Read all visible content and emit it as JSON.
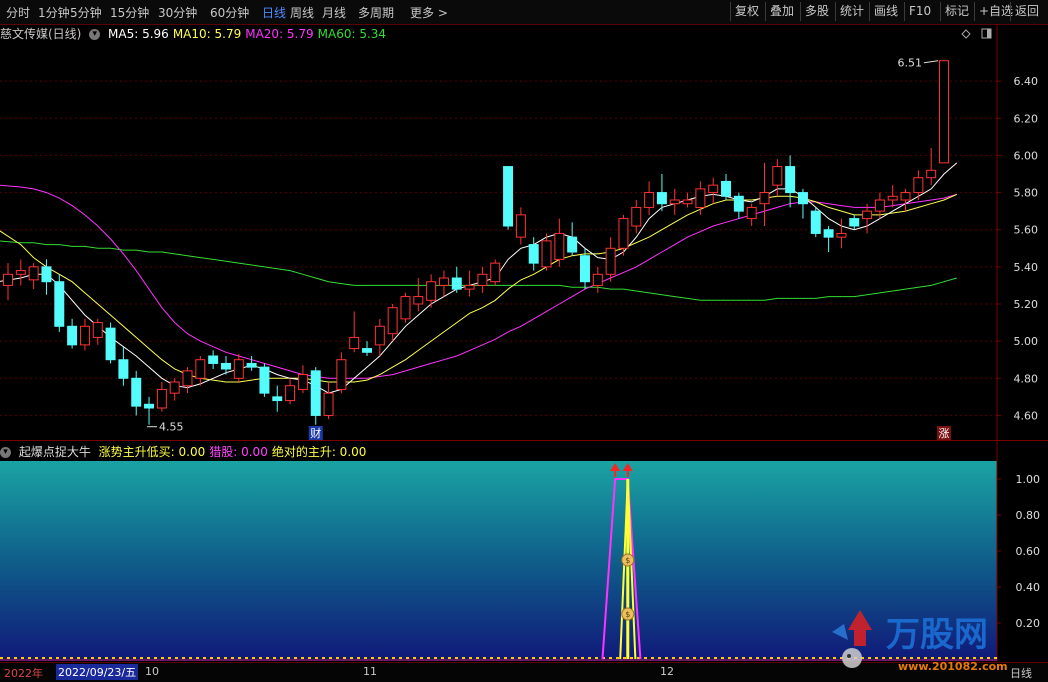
{
  "toolbar": {
    "periods": [
      {
        "label": "分时",
        "active": false
      },
      {
        "label": "1分钟",
        "active": false
      },
      {
        "label": "5分钟",
        "active": false
      },
      {
        "label": "15分钟",
        "active": false
      },
      {
        "label": "30分钟",
        "active": false
      },
      {
        "label": "60分钟",
        "active": false
      },
      {
        "label": "日线",
        "active": true
      },
      {
        "label": "周线",
        "active": false
      },
      {
        "label": "月线",
        "active": false
      },
      {
        "label": "多周期",
        "active": false
      },
      {
        "label": "更多 >",
        "active": false
      }
    ],
    "buttons": [
      "复权",
      "叠加",
      "多股",
      "统计",
      "画线",
      "F10",
      "标记",
      "+自选",
      "返回"
    ]
  },
  "stock": {
    "name": "慈文传媒(日线)",
    "ma": [
      {
        "label": "MA5: 5.96",
        "color": "#ffffff"
      },
      {
        "label": "MA10: 5.79",
        "color": "#ffff55"
      },
      {
        "label": "MA20: 5.79",
        "color": "#ff33ff"
      },
      {
        "label": "MA60: 5.34",
        "color": "#33dd33"
      }
    ]
  },
  "colors": {
    "up": "#ff3333",
    "down": "#54fcfc",
    "axis_line": "#7a0000",
    "grid": "#5a0000"
  },
  "chart_data": [
    {
      "type": "candlestick",
      "title": "慈文传媒(日线)",
      "yticks": [
        4.6,
        4.8,
        5.0,
        5.2,
        5.4,
        5.6,
        5.8,
        6.0,
        6.2,
        6.4
      ],
      "ylim": [
        4.5,
        6.6
      ],
      "annotations": {
        "high_label": "6.51",
        "low_label": "4.55",
        "marker_cai": "财",
        "marker_zhang": "涨"
      },
      "candles": [
        {
          "o": 5.3,
          "h": 5.42,
          "l": 5.22,
          "c": 5.36
        },
        {
          "o": 5.36,
          "h": 5.44,
          "l": 5.3,
          "c": 5.38
        },
        {
          "o": 5.33,
          "h": 5.42,
          "l": 5.28,
          "c": 5.4
        },
        {
          "o": 5.4,
          "h": 5.44,
          "l": 5.25,
          "c": 5.32
        },
        {
          "o": 5.32,
          "h": 5.36,
          "l": 5.05,
          "c": 5.08
        },
        {
          "o": 5.08,
          "h": 5.12,
          "l": 4.96,
          "c": 4.98
        },
        {
          "o": 4.98,
          "h": 5.12,
          "l": 4.95,
          "c": 5.08
        },
        {
          "o": 5.02,
          "h": 5.12,
          "l": 4.98,
          "c": 5.1
        },
        {
          "o": 5.07,
          "h": 5.1,
          "l": 4.88,
          "c": 4.9
        },
        {
          "o": 4.9,
          "h": 4.97,
          "l": 4.76,
          "c": 4.8
        },
        {
          "o": 4.8,
          "h": 4.84,
          "l": 4.6,
          "c": 4.65
        },
        {
          "o": 4.66,
          "h": 4.7,
          "l": 4.55,
          "c": 4.64
        },
        {
          "o": 4.64,
          "h": 4.78,
          "l": 4.62,
          "c": 4.74
        },
        {
          "o": 4.72,
          "h": 4.8,
          "l": 4.68,
          "c": 4.78
        },
        {
          "o": 4.76,
          "h": 4.86,
          "l": 4.72,
          "c": 4.84
        },
        {
          "o": 4.8,
          "h": 4.92,
          "l": 4.76,
          "c": 4.9
        },
        {
          "o": 4.92,
          "h": 4.95,
          "l": 4.85,
          "c": 4.88
        },
        {
          "o": 4.88,
          "h": 4.92,
          "l": 4.82,
          "c": 4.85
        },
        {
          "o": 4.8,
          "h": 4.93,
          "l": 4.78,
          "c": 4.9
        },
        {
          "o": 4.88,
          "h": 4.92,
          "l": 4.84,
          "c": 4.86
        },
        {
          "o": 4.86,
          "h": 4.88,
          "l": 4.7,
          "c": 4.72
        },
        {
          "o": 4.7,
          "h": 4.76,
          "l": 4.62,
          "c": 4.68
        },
        {
          "o": 4.68,
          "h": 4.8,
          "l": 4.66,
          "c": 4.76
        },
        {
          "o": 4.74,
          "h": 4.87,
          "l": 4.72,
          "c": 4.82
        },
        {
          "o": 4.84,
          "h": 4.86,
          "l": 4.55,
          "c": 4.6
        },
        {
          "o": 4.6,
          "h": 4.78,
          "l": 4.58,
          "c": 4.72
        },
        {
          "o": 4.74,
          "h": 4.94,
          "l": 4.72,
          "c": 4.9
        },
        {
          "o": 4.96,
          "h": 5.16,
          "l": 4.94,
          "c": 5.02
        },
        {
          "o": 4.96,
          "h": 5.0,
          "l": 4.92,
          "c": 4.94
        },
        {
          "o": 4.98,
          "h": 5.12,
          "l": 4.92,
          "c": 5.08
        },
        {
          "o": 5.04,
          "h": 5.2,
          "l": 5.0,
          "c": 5.18
        },
        {
          "o": 5.12,
          "h": 5.26,
          "l": 5.1,
          "c": 5.24
        },
        {
          "o": 5.2,
          "h": 5.34,
          "l": 5.16,
          "c": 5.24
        },
        {
          "o": 5.22,
          "h": 5.36,
          "l": 5.18,
          "c": 5.32
        },
        {
          "o": 5.3,
          "h": 5.38,
          "l": 5.24,
          "c": 5.34
        },
        {
          "o": 5.34,
          "h": 5.4,
          "l": 5.26,
          "c": 5.28
        },
        {
          "o": 5.28,
          "h": 5.38,
          "l": 5.24,
          "c": 5.3
        },
        {
          "o": 5.3,
          "h": 5.4,
          "l": 5.26,
          "c": 5.36
        },
        {
          "o": 5.32,
          "h": 5.44,
          "l": 5.3,
          "c": 5.42
        },
        {
          "o": 5.94,
          "h": 5.94,
          "l": 5.6,
          "c": 5.62
        },
        {
          "o": 5.56,
          "h": 5.72,
          "l": 5.52,
          "c": 5.68
        },
        {
          "o": 5.52,
          "h": 5.56,
          "l": 5.38,
          "c": 5.42
        },
        {
          "o": 5.4,
          "h": 5.58,
          "l": 5.38,
          "c": 5.54
        },
        {
          "o": 5.44,
          "h": 5.66,
          "l": 5.4,
          "c": 5.58
        },
        {
          "o": 5.56,
          "h": 5.64,
          "l": 5.46,
          "c": 5.48
        },
        {
          "o": 5.46,
          "h": 5.5,
          "l": 5.28,
          "c": 5.32
        },
        {
          "o": 5.3,
          "h": 5.4,
          "l": 5.26,
          "c": 5.36
        },
        {
          "o": 5.36,
          "h": 5.56,
          "l": 5.32,
          "c": 5.5
        },
        {
          "o": 5.5,
          "h": 5.68,
          "l": 5.46,
          "c": 5.66
        },
        {
          "o": 5.62,
          "h": 5.76,
          "l": 5.58,
          "c": 5.72
        },
        {
          "o": 5.72,
          "h": 5.86,
          "l": 5.68,
          "c": 5.8
        },
        {
          "o": 5.8,
          "h": 5.9,
          "l": 5.7,
          "c": 5.74
        },
        {
          "o": 5.74,
          "h": 5.82,
          "l": 5.68,
          "c": 5.76
        },
        {
          "o": 5.74,
          "h": 5.8,
          "l": 5.72,
          "c": 5.76
        },
        {
          "o": 5.72,
          "h": 5.86,
          "l": 5.68,
          "c": 5.82
        },
        {
          "o": 5.8,
          "h": 5.88,
          "l": 5.74,
          "c": 5.84
        },
        {
          "o": 5.86,
          "h": 5.9,
          "l": 5.76,
          "c": 5.78
        },
        {
          "o": 5.78,
          "h": 5.8,
          "l": 5.66,
          "c": 5.7
        },
        {
          "o": 5.66,
          "h": 5.74,
          "l": 5.62,
          "c": 5.72
        },
        {
          "o": 5.74,
          "h": 5.96,
          "l": 5.62,
          "c": 5.8
        },
        {
          "o": 5.84,
          "h": 5.98,
          "l": 5.78,
          "c": 5.94
        },
        {
          "o": 5.94,
          "h": 6.0,
          "l": 5.72,
          "c": 5.8
        },
        {
          "o": 5.8,
          "h": 5.82,
          "l": 5.66,
          "c": 5.74
        },
        {
          "o": 5.7,
          "h": 5.72,
          "l": 5.56,
          "c": 5.58
        },
        {
          "o": 5.6,
          "h": 5.62,
          "l": 5.48,
          "c": 5.56
        },
        {
          "o": 5.56,
          "h": 5.66,
          "l": 5.5,
          "c": 5.58
        },
        {
          "o": 5.66,
          "h": 5.68,
          "l": 5.6,
          "c": 5.62
        },
        {
          "o": 5.66,
          "h": 5.74,
          "l": 5.58,
          "c": 5.7
        },
        {
          "o": 5.7,
          "h": 5.8,
          "l": 5.66,
          "c": 5.76
        },
        {
          "o": 5.76,
          "h": 5.84,
          "l": 5.72,
          "c": 5.78
        },
        {
          "o": 5.76,
          "h": 5.82,
          "l": 5.7,
          "c": 5.8
        },
        {
          "o": 5.8,
          "h": 5.92,
          "l": 5.76,
          "c": 5.88
        },
        {
          "o": 5.88,
          "h": 6.04,
          "l": 5.84,
          "c": 5.92
        },
        {
          "o": 5.96,
          "h": 6.51,
          "l": 5.96,
          "c": 6.51
        }
      ],
      "ma_values": {
        "ma5": [
          5.32,
          5.34,
          5.36,
          5.36,
          5.3,
          5.22,
          5.14,
          5.08,
          5.02,
          4.97,
          4.92,
          4.86,
          4.8,
          4.76,
          4.75,
          4.77,
          4.8,
          4.83,
          4.85,
          4.87,
          4.85,
          4.82,
          4.8,
          4.79,
          4.76,
          4.72,
          4.74,
          4.8,
          4.86,
          4.92,
          5.0,
          5.08,
          5.14,
          5.2,
          5.24,
          5.28,
          5.3,
          5.32,
          5.34,
          5.44,
          5.5,
          5.52,
          5.56,
          5.58,
          5.56,
          5.5,
          5.45,
          5.44,
          5.48,
          5.56,
          5.66,
          5.72,
          5.74,
          5.76,
          5.78,
          5.79,
          5.78,
          5.76,
          5.75,
          5.78,
          5.82,
          5.82,
          5.78,
          5.72,
          5.66,
          5.62,
          5.6,
          5.62,
          5.66,
          5.7,
          5.74,
          5.78,
          5.82,
          5.9,
          5.96
        ],
        "ma10": [
          5.6,
          5.52,
          5.45,
          5.4,
          5.36,
          5.32,
          5.26,
          5.2,
          5.14,
          5.08,
          5.02,
          4.96,
          4.9,
          4.85,
          4.82,
          4.8,
          4.79,
          4.78,
          4.78,
          4.79,
          4.8,
          4.8,
          4.8,
          4.8,
          4.79,
          4.78,
          4.78,
          4.78,
          4.79,
          4.82,
          4.86,
          4.9,
          4.95,
          5.0,
          5.05,
          5.1,
          5.15,
          5.18,
          5.22,
          5.28,
          5.33,
          5.36,
          5.4,
          5.44,
          5.46,
          5.47,
          5.47,
          5.48,
          5.5,
          5.53,
          5.56,
          5.6,
          5.64,
          5.68,
          5.71,
          5.74,
          5.76,
          5.76,
          5.76,
          5.77,
          5.78,
          5.78,
          5.77,
          5.75,
          5.72,
          5.7,
          5.68,
          5.68,
          5.68,
          5.69,
          5.7,
          5.72,
          5.74,
          5.76,
          5.79
        ],
        "ma20": [
          5.84,
          5.83,
          5.82,
          5.8,
          5.77,
          5.73,
          5.68,
          5.62,
          5.55,
          5.47,
          5.38,
          5.28,
          5.18,
          5.1,
          5.04,
          5.0,
          4.97,
          4.94,
          4.92,
          4.9,
          4.88,
          4.86,
          4.84,
          4.82,
          4.81,
          4.8,
          4.8,
          4.8,
          4.8,
          4.81,
          4.82,
          4.84,
          4.86,
          4.88,
          4.9,
          4.92,
          4.95,
          4.98,
          5.01,
          5.05,
          5.08,
          5.12,
          5.16,
          5.2,
          5.24,
          5.28,
          5.31,
          5.34,
          5.37,
          5.4,
          5.44,
          5.48,
          5.52,
          5.56,
          5.59,
          5.62,
          5.64,
          5.66,
          5.68,
          5.7,
          5.72,
          5.74,
          5.75,
          5.75,
          5.74,
          5.73,
          5.72,
          5.72,
          5.72,
          5.73,
          5.74,
          5.75,
          5.76,
          5.77,
          5.79
        ],
        "ma60": [
          5.54,
          5.53,
          5.53,
          5.52,
          5.52,
          5.51,
          5.51,
          5.5,
          5.5,
          5.49,
          5.49,
          5.48,
          5.48,
          5.47,
          5.46,
          5.45,
          5.44,
          5.43,
          5.42,
          5.41,
          5.4,
          5.39,
          5.38,
          5.36,
          5.34,
          5.32,
          5.31,
          5.3,
          5.3,
          5.3,
          5.3,
          5.3,
          5.3,
          5.3,
          5.3,
          5.3,
          5.3,
          5.3,
          5.3,
          5.3,
          5.3,
          5.3,
          5.3,
          5.3,
          5.29,
          5.29,
          5.29,
          5.28,
          5.28,
          5.27,
          5.26,
          5.25,
          5.24,
          5.23,
          5.22,
          5.22,
          5.22,
          5.22,
          5.22,
          5.22,
          5.23,
          5.23,
          5.23,
          5.23,
          5.24,
          5.24,
          5.24,
          5.25,
          5.26,
          5.27,
          5.28,
          5.29,
          5.3,
          5.32,
          5.34
        ]
      }
    },
    {
      "type": "line",
      "title": "起爆点捉大牛",
      "legend": [
        {
          "label": "涨势主升低买: 0.00",
          "color": "#ffff44"
        },
        {
          "label": "猎股: 0.00",
          "color": "#ff44ff"
        },
        {
          "label": "绝对的主升: 0.00",
          "color": "#ffff44"
        }
      ],
      "yticks": [
        0.2,
        0.4,
        0.6,
        0.8,
        1.0
      ],
      "ylim": [
        0,
        1.1
      ],
      "signals": {
        "magenta_window": [
          48,
          49
        ],
        "yellow_index": 49
      }
    }
  ],
  "bottom": {
    "year": "2022年",
    "date": "2022/09/23/五",
    "months": [
      "10",
      "11",
      "12"
    ],
    "period": "日线"
  },
  "watermark": {
    "text": "万股网",
    "url": "www.201082.com"
  }
}
